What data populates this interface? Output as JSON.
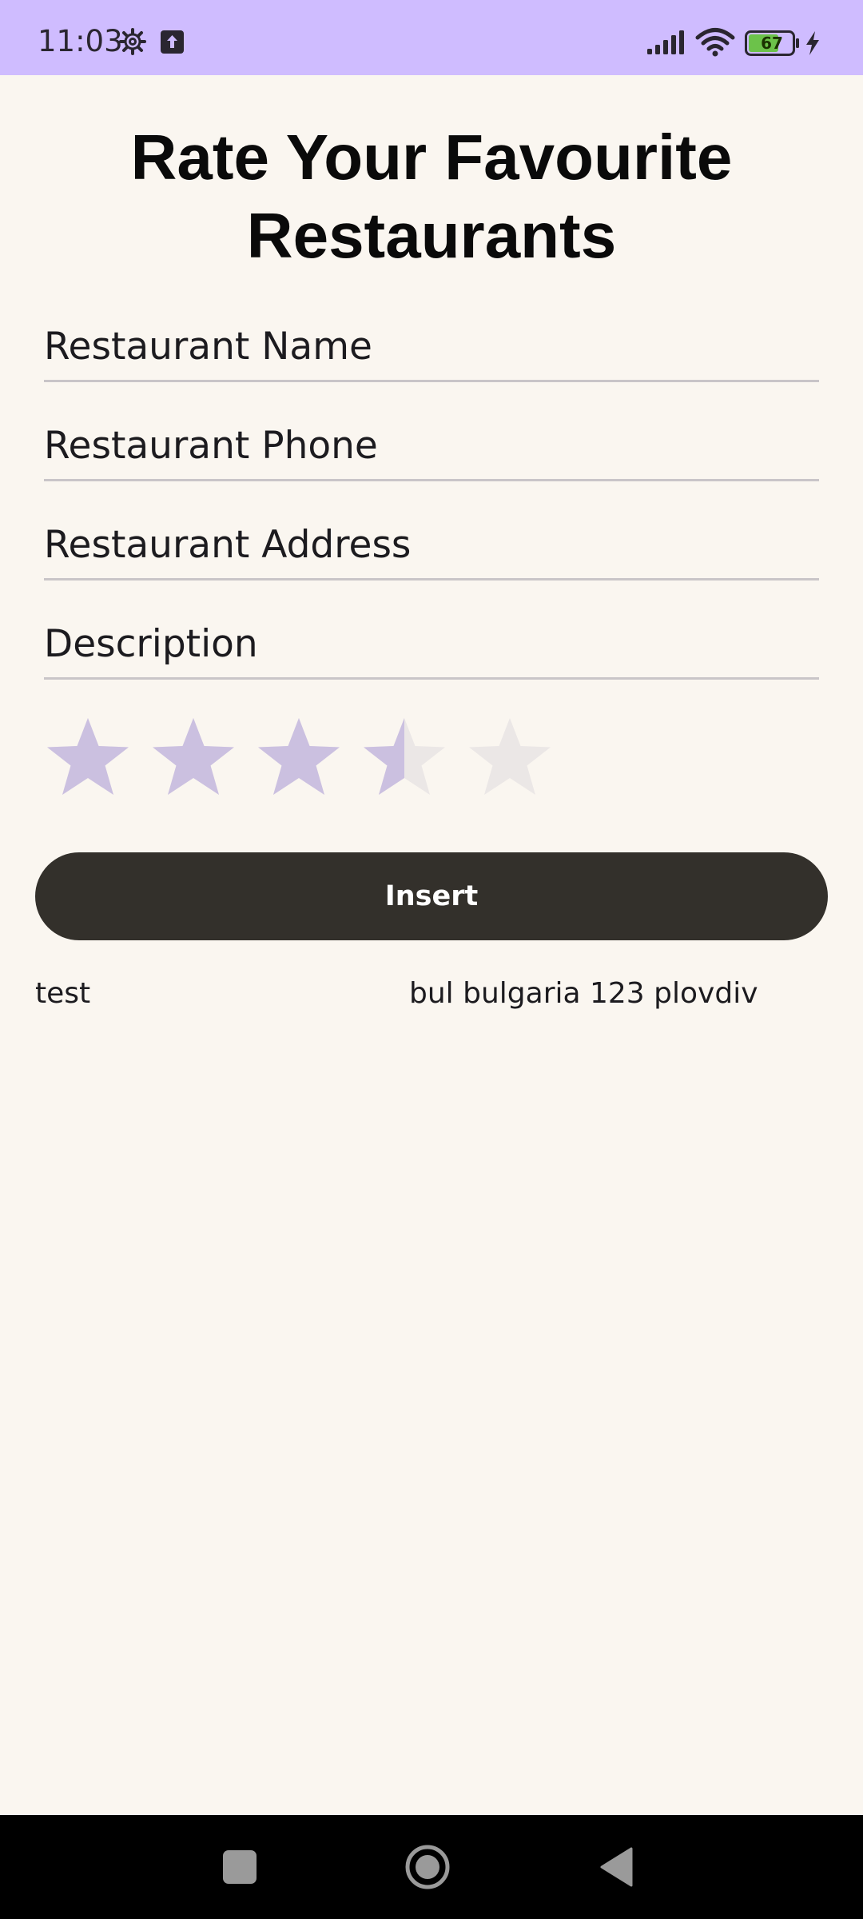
{
  "status_bar": {
    "time": "11:03",
    "battery": "67",
    "icons": [
      "gear-icon",
      "upload-icon",
      "signal-icon",
      "wifi-icon",
      "battery-icon",
      "charging-bolt-icon"
    ],
    "background_color": "#cfbcff"
  },
  "page": {
    "title": "Rate Your Favourite Restaurants",
    "background_color": "#faf6f0"
  },
  "form": {
    "name_placeholder": "Restaurant Name",
    "name_value": "",
    "phone_placeholder": "Restaurant Phone",
    "phone_value": "",
    "address_placeholder": "Restaurant Address",
    "address_value": "",
    "description_placeholder": "Description",
    "description_value": ""
  },
  "rating": {
    "value": 3.5,
    "max": 5,
    "filled_color": "#cbc0e0",
    "empty_color": "#ebe7e6",
    "icon": "star-icon"
  },
  "actions": {
    "insert_label": "Insert",
    "button_color": "#33302b"
  },
  "restaurants": [
    {
      "name": "test",
      "address": "bul bulgaria 123 plovdiv"
    }
  ],
  "nav_bar": {
    "icons": [
      "recents-icon",
      "home-icon",
      "back-icon"
    ]
  }
}
